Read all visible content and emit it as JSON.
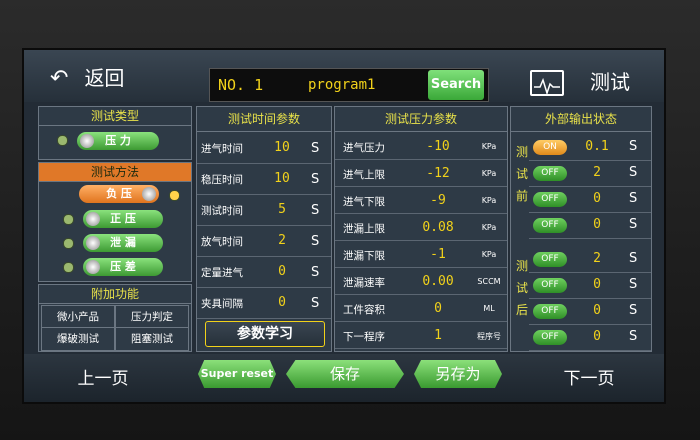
{
  "header": {
    "back_label": "返回",
    "program_no": "NO. 1",
    "program_name": "program1",
    "search_label": "Search",
    "test_label": "测试"
  },
  "left": {
    "test_type_title": "测试类型",
    "test_type_value": "压  力",
    "test_method_title": "测试方法",
    "methods": [
      "负  压",
      "正  压",
      "泄  漏",
      "压  差"
    ],
    "additional_title": "附加功能",
    "functions": [
      "微小产品",
      "压力判定",
      "爆破测试",
      "阻塞测试"
    ]
  },
  "time_params": {
    "title": "测试时间参数",
    "rows": [
      {
        "label": "进气时间",
        "value": "10",
        "unit": "S"
      },
      {
        "label": "稳压时间",
        "value": "10",
        "unit": "S"
      },
      {
        "label": "测试时间",
        "value": "5",
        "unit": "S"
      },
      {
        "label": "放气时间",
        "value": "2",
        "unit": "S"
      },
      {
        "label": "定量进气",
        "value": "0",
        "unit": "S"
      },
      {
        "label": "夹具间隔",
        "value": "0",
        "unit": "S"
      }
    ],
    "learn_label": "参数学习"
  },
  "pressure_params": {
    "title": "测试压力参数",
    "rows": [
      {
        "label": "进气压力",
        "value": "-10",
        "unit": "KPa"
      },
      {
        "label": "进气上限",
        "value": "-12",
        "unit": "KPa"
      },
      {
        "label": "进气下限",
        "value": "-9",
        "unit": "KPa"
      },
      {
        "label": "泄漏上限",
        "value": "0.08",
        "unit": "KPa"
      },
      {
        "label": "泄漏下限",
        "value": "-1",
        "unit": "KPa"
      },
      {
        "label": "泄漏速率",
        "value": "0.00",
        "unit": "SCCM"
      },
      {
        "label": "工件容积",
        "value": "0",
        "unit": "ML"
      },
      {
        "label": "下一程序",
        "value": "1",
        "unit": "程序号"
      }
    ]
  },
  "output_status": {
    "title": "外部输出状态",
    "before_label": "测试前",
    "after_label": "测试后",
    "before_rows": [
      {
        "state": "ON",
        "value": "0.1",
        "unit": "S"
      },
      {
        "state": "OFF",
        "value": "2",
        "unit": "S"
      },
      {
        "state": "OFF",
        "value": "0",
        "unit": "S"
      },
      {
        "state": "OFF",
        "value": "0",
        "unit": "S"
      }
    ],
    "after_rows": [
      {
        "state": "OFF",
        "value": "2",
        "unit": "S"
      },
      {
        "state": "OFF",
        "value": "0",
        "unit": "S"
      },
      {
        "state": "OFF",
        "value": "0",
        "unit": "S"
      },
      {
        "state": "OFF",
        "value": "0",
        "unit": "S"
      }
    ]
  },
  "footer": {
    "prev_label": "上一页",
    "super_reset_label": "Super reset",
    "save_label": "保存",
    "save_as_label": "另存为",
    "next_label": "下一页"
  }
}
